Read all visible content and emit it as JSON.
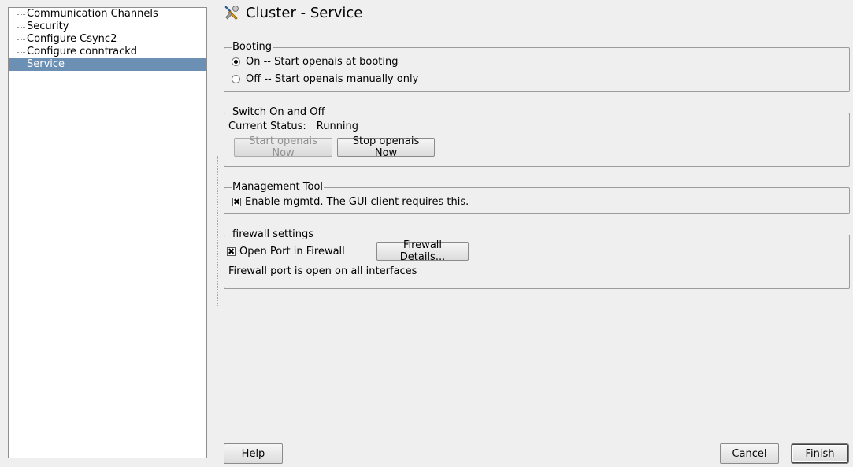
{
  "tree": {
    "items": [
      {
        "label": "Communication Channels",
        "selected": false
      },
      {
        "label": "Security",
        "selected": false
      },
      {
        "label": "Configure Csync2",
        "selected": false
      },
      {
        "label": "Configure conntrackd",
        "selected": false
      },
      {
        "label": "Service",
        "selected": true
      }
    ]
  },
  "header": {
    "title": "Cluster - Service",
    "icon": "wrench-screwdriver-icon"
  },
  "booting": {
    "legend": "Booting",
    "option_on": "On -- Start openais at booting",
    "option_off": "Off -- Start openais manually only",
    "selected": "on"
  },
  "switch": {
    "legend": "Switch On and Off",
    "status_label": "Current Status:",
    "status_value": "Running",
    "start_button": "Start openais Now",
    "stop_button": "Stop openais Now",
    "start_enabled": false
  },
  "management": {
    "legend": "Management Tool",
    "checkbox_label": "Enable mgmtd. The GUI client requires this.",
    "checked": true
  },
  "firewall": {
    "legend": "firewall settings",
    "checkbox_label": "Open Port in Firewall",
    "checked": true,
    "details_button": "Firewall Details...",
    "status_text": "Firewall port is open on all interfaces"
  },
  "footer": {
    "help": "Help",
    "cancel": "Cancel",
    "finish": "Finish"
  },
  "colors": {
    "selection": "#6c8fb4",
    "background": "#efefef"
  }
}
